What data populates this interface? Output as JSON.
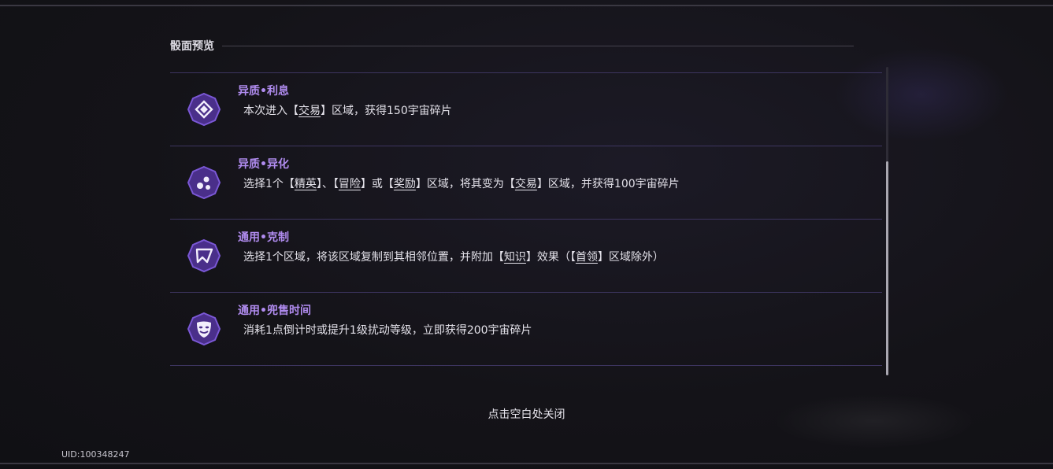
{
  "panel": {
    "title": "骰面预览"
  },
  "items": [
    {
      "icon": "diamond-rune-icon",
      "title": "异质•利息",
      "desc": [
        {
          "t": "本次进入【"
        },
        {
          "t": "交易",
          "u": true
        },
        {
          "t": "】区域，获得150宇宙碎片"
        }
      ]
    },
    {
      "icon": "mutation-dots-icon",
      "title": "异质•异化",
      "desc": [
        {
          "t": "选择1个【"
        },
        {
          "t": "精英",
          "u": true
        },
        {
          "t": "】、【"
        },
        {
          "t": "冒险",
          "u": true
        },
        {
          "t": "】或【"
        },
        {
          "t": "奖励",
          "u": true
        },
        {
          "t": "】区域，将其变为【"
        },
        {
          "t": "交易",
          "u": true
        },
        {
          "t": "】区域，并获得100宇宙碎片"
        }
      ]
    },
    {
      "icon": "counter-rune-icon",
      "title": "通用•克制",
      "desc": [
        {
          "t": "选择1个区域，将该区域复制到其相邻位置，并附加【"
        },
        {
          "t": "知识",
          "u": true
        },
        {
          "t": "】效果（【"
        },
        {
          "t": "首领",
          "u": true
        },
        {
          "t": "】区域除外）"
        }
      ]
    },
    {
      "icon": "mask-face-icon",
      "title": "通用•兜售时间",
      "desc": [
        {
          "t": "消耗1点倒计时或提升1级扰动等级，立即获得200宇宙碎片"
        }
      ]
    }
  ],
  "footer": {
    "close_hint": "点击空白处关闭",
    "uid": "UID:100348247"
  },
  "colors": {
    "accent": "#b18cf0",
    "divider": "#3d3560",
    "icon_fill": "#4a2f8a",
    "icon_ring": "#7b58d6"
  }
}
